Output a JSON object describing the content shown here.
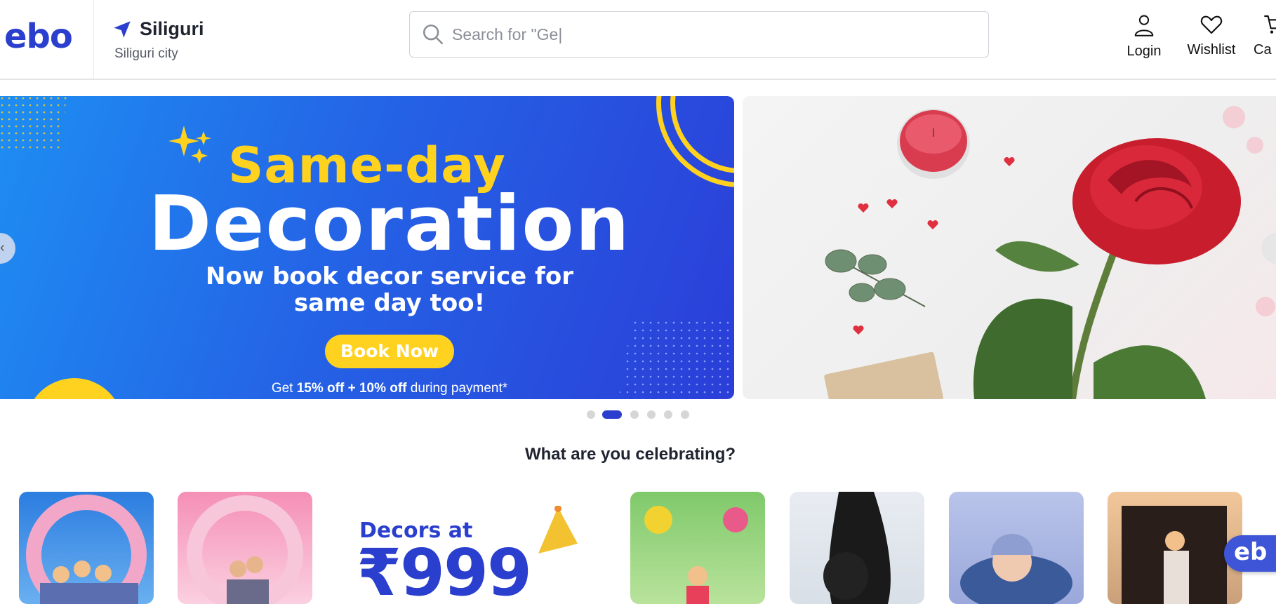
{
  "header": {
    "logo": "ebo",
    "location": {
      "city": "Siliguri",
      "sub": "Siliguri city"
    },
    "search": {
      "placeholder": "Search for \"Ge|"
    },
    "actions": [
      {
        "label": "Login",
        "icon": "user-icon"
      },
      {
        "label": "Wishlist",
        "icon": "heart-icon"
      },
      {
        "label": "Ca",
        "icon": "cart-icon"
      }
    ]
  },
  "banner": {
    "title_line1": "Same-day",
    "title_line2": "Decoration",
    "subtitle_line1": "Now book decor service for",
    "subtitle_line2": "same day too!",
    "button": "Book Now",
    "footnote_prefix": "Get ",
    "footnote_bold": "15% off + 10% off",
    "footnote_suffix": " during payment*",
    "colors": {
      "accent": "#ffd21f",
      "bg_start": "#1e8ef2",
      "bg_end": "#2b3ed8"
    }
  },
  "carousel": {
    "dot_count": 6,
    "active_index": 1
  },
  "section": {
    "title": "What are you celebrating?"
  },
  "categories": [
    {
      "name": "birthday-family"
    },
    {
      "name": "birthday-couple"
    },
    {
      "name": "decors-promo",
      "line1": "Decors at",
      "line2": "₹999"
    },
    {
      "name": "kids-birthday"
    },
    {
      "name": "baby-shower"
    },
    {
      "name": "newborn"
    },
    {
      "name": "balloon-backdrop"
    }
  ],
  "chat": {
    "label": "eb"
  },
  "colors": {
    "brand": "#2b3fce"
  }
}
